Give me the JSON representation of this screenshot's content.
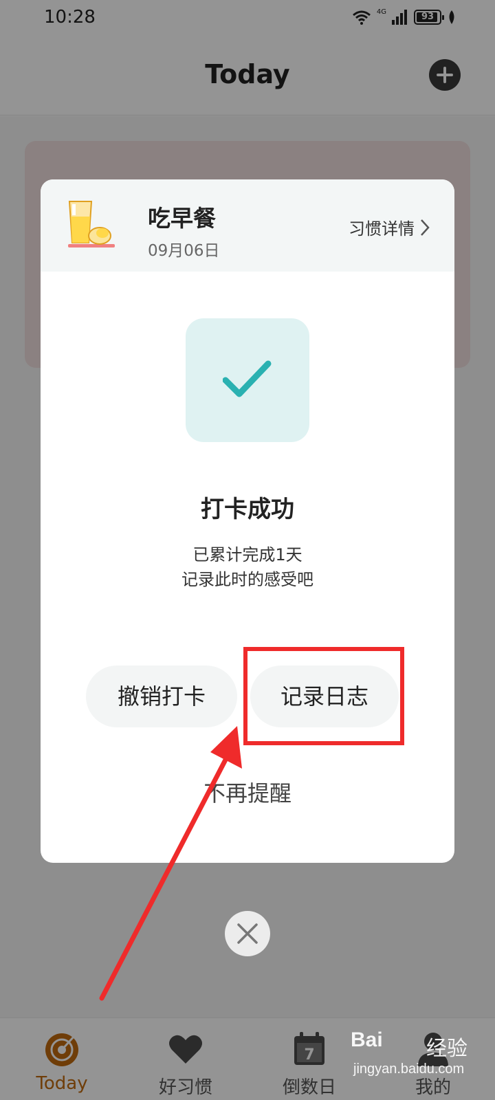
{
  "status_bar": {
    "time": "10:28",
    "network": "4G",
    "battery": "93",
    "battery_level": 0.93
  },
  "header": {
    "title": "Today",
    "add_icon": "plus-circle-icon"
  },
  "dialog": {
    "habit_name": "吃早餐",
    "habit_date": "09月06日",
    "details_link": "习惯详情",
    "success_title": "打卡成功",
    "success_line1": "已累计完成1天",
    "success_line2": "记录此时的感受吧",
    "undo_button": "撤销打卡",
    "log_button": "记录日志",
    "dismiss_link": "不再提醒"
  },
  "tabs": [
    {
      "label": "Today",
      "icon": "target-icon",
      "active": true
    },
    {
      "label": "好习惯",
      "icon": "heart-icon",
      "active": false
    },
    {
      "label": "倒数日",
      "icon": "calendar-icon",
      "active": false
    },
    {
      "label": "我的",
      "icon": "person-icon",
      "active": false
    }
  ],
  "calendar_icon_day": "7",
  "watermark": {
    "logo": "Bai",
    "text": "经验",
    "url": "jingyan.baidu.com"
  },
  "colors": {
    "accent": "#c06a0e",
    "teal": "#2ab1b1",
    "annotation": "#ef2b2b"
  }
}
